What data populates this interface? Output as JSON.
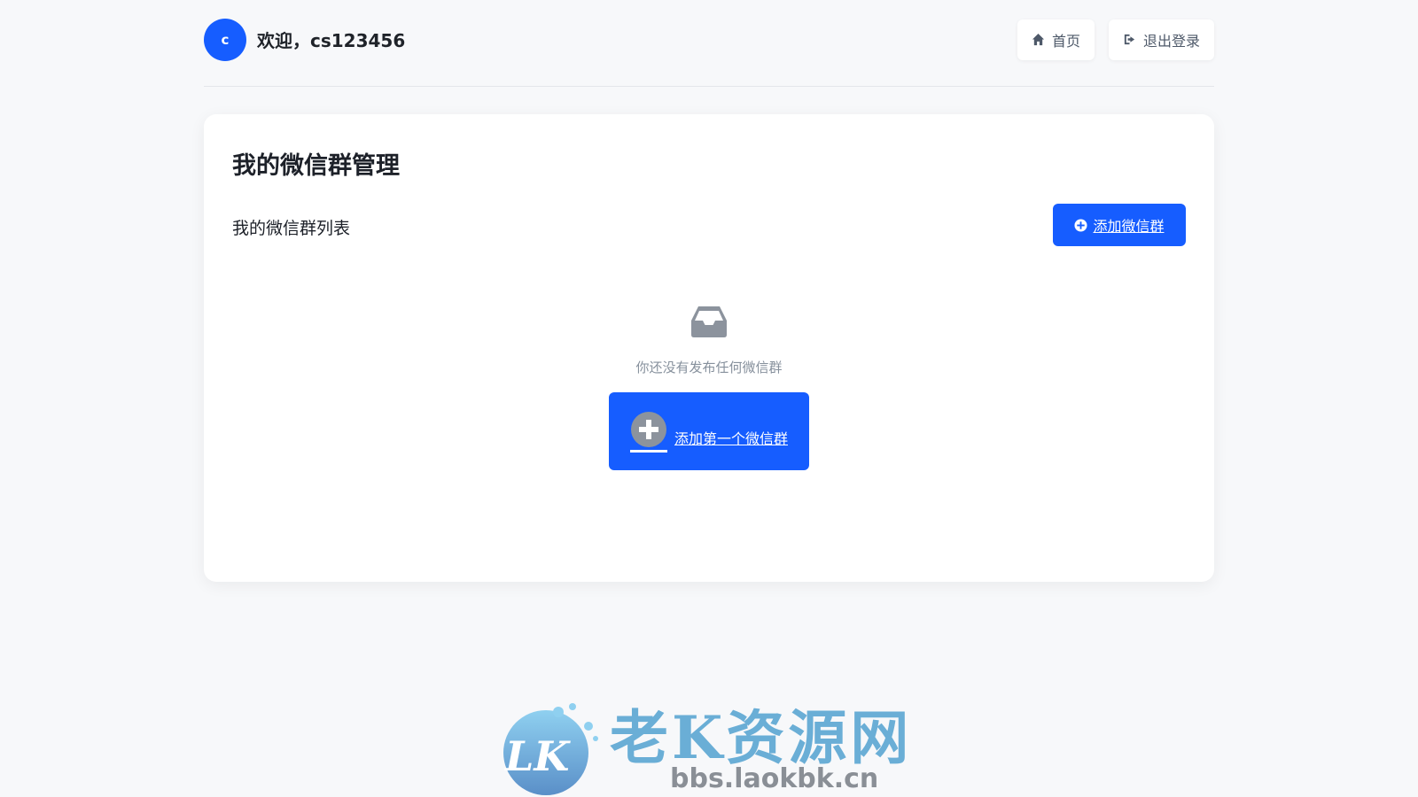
{
  "header": {
    "avatar_letter": "c",
    "welcome_text": "欢迎，cs123456",
    "home_label": "首页",
    "logout_label": "退出登录"
  },
  "card": {
    "title": "我的微信群管理",
    "list_title": "我的微信群列表",
    "add_button_label": "添加微信群",
    "empty_text": "你还没有发布任何微信群",
    "add_first_label": "添加第一个微信群"
  },
  "watermark": {
    "logo_text": "LK",
    "title": "老K资源网",
    "url": "bbs.laokbk.cn"
  },
  "colors": {
    "primary": "#165dff",
    "background": "#f7f8fa",
    "watermark_blue": "#6aaed6"
  },
  "icons": {
    "home": "home-icon",
    "logout": "sign-out-icon",
    "add": "plus-circle-icon",
    "empty": "inbox-icon"
  }
}
